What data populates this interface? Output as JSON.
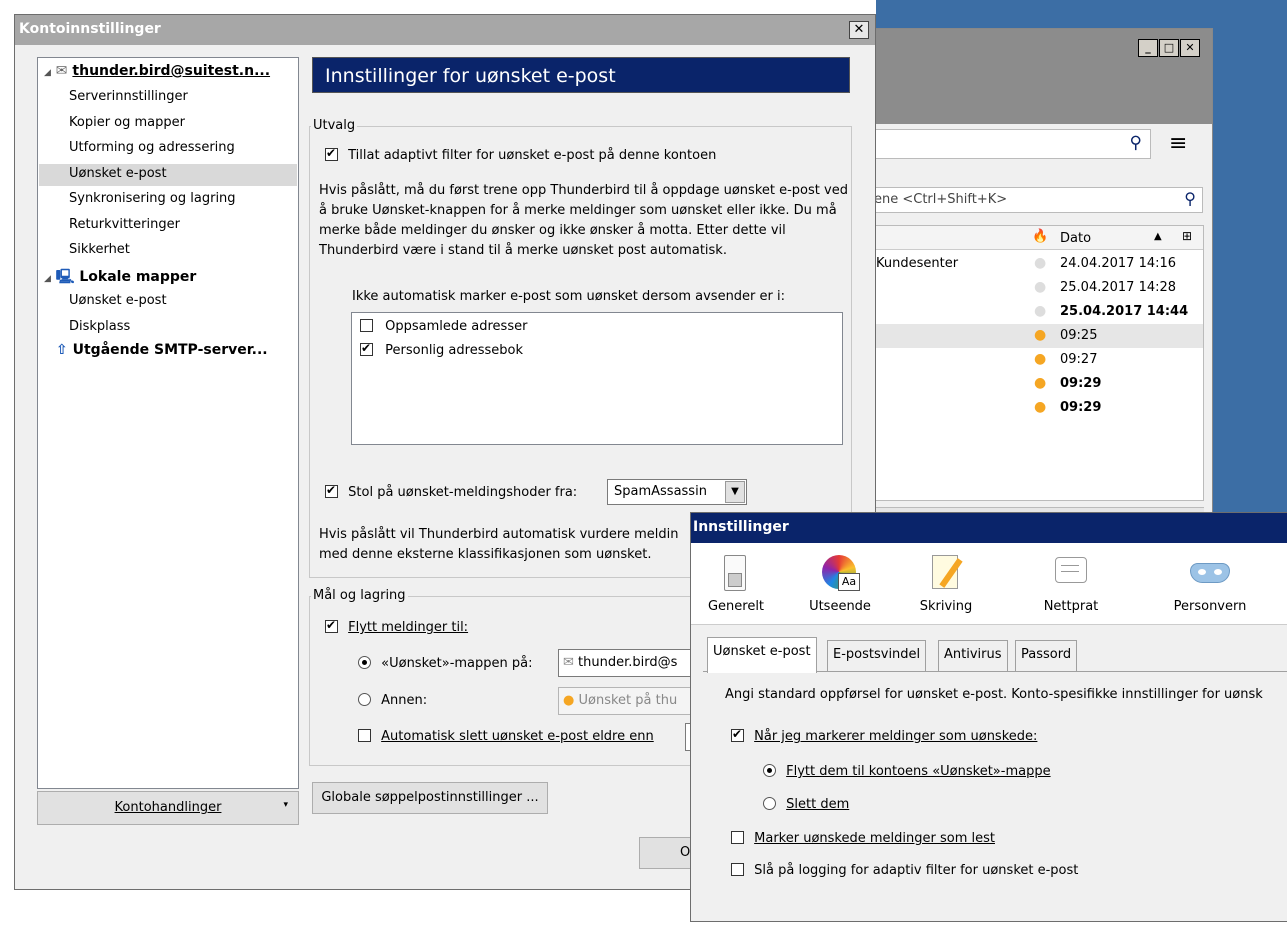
{
  "background_window": {
    "search_icon": "search-icon",
    "menu_icon": "hamburger-menu-icon",
    "quickfilter_placeholder": "ene <Ctrl+Shift+K>",
    "columns": {
      "junk": "junk-icon",
      "date": "Dato"
    },
    "rows": [
      {
        "from": "Kundesenter",
        "date": "24.04.2017 14:16",
        "bold": false,
        "junk": false
      },
      {
        "from": "",
        "date": "25.04.2017 14:28",
        "bold": false,
        "junk": false
      },
      {
        "from": "",
        "date": "25.04.2017 14:44",
        "bold": true,
        "junk": false
      },
      {
        "from": "",
        "date": "09:25",
        "bold": false,
        "junk": true
      },
      {
        "from": "",
        "date": "09:27",
        "bold": false,
        "junk": true
      },
      {
        "from": "",
        "date": "09:29",
        "bold": true,
        "junk": true
      },
      {
        "from": "",
        "date": "09:29",
        "bold": true,
        "junk": true
      }
    ]
  },
  "account_dialog": {
    "title": "Kontoinnstillinger",
    "close_label": "✕",
    "tree": {
      "account": "thunder.bird@suitest.n...",
      "account_items": [
        "Serverinnstillinger",
        "Kopier og mapper",
        "Utforming og adressering",
        "Uønsket e-post",
        "Synkronisering og lagring",
        "Returkvitteringer",
        "Sikkerhet"
      ],
      "local": "Lokale mapper",
      "local_items": [
        "Uønsket e-post",
        "Diskplass"
      ],
      "smtp": "Utgående SMTP-server..."
    },
    "account_actions": "Kontohandlinger",
    "heading": "Innstillinger for uønsket e-post",
    "selection_group": "Utvalg",
    "adaptive_filter_label": "Tillat adaptivt filter for uønsket e-post på denne kontoen",
    "adaptive_filter_checked": true,
    "explanation": "Hvis påslått, må du først trene opp Thunderbird til å oppdage uønsket e-post ved å bruke Uønsket-knappen for å merke meldinger som uønsket eller ikke. Du må merke både meldinger du ønsker og ikke ønsker å motta. Etter dette vil Thunderbird være i stand til å merke uønsket post automatisk.",
    "whitelist_label": "Ikke automatisk marker e-post som uønsket dersom avsender er i:",
    "whitelist": [
      {
        "label": "Oppsamlede adresser",
        "checked": false
      },
      {
        "label": "Personlig adressebok",
        "checked": true
      }
    ],
    "trust_headers_label": "Stol på uønsket-meldingshoder fra:",
    "trust_headers_checked": true,
    "trust_headers_value": "SpamAssassin",
    "trust_explanation_1": "Hvis påslått vil Thunderbird automatisk vurdere meldin",
    "trust_explanation_2": "med denne eksterne klassifikasjonen som uønsket.",
    "destination_group": "Mål og lagring",
    "move_label": "Flytt meldinger til:",
    "move_checked": true,
    "junk_folder_on_label": "«Uønsket»-mappen på:",
    "junk_folder_on_value": "thunder.bird@s",
    "other_label": "Annen:",
    "other_value": "Uønsket på thu",
    "auto_delete_label": "Automatisk slett uønsket e-post eldre enn",
    "auto_delete_checked": false,
    "global_button": "Globale søppelpostinnstillinger ...",
    "ok_button": "O"
  },
  "prefs_dialog": {
    "title": "Innstillinger",
    "panes": [
      {
        "label": "Generelt",
        "icon": "general-switch-icon"
      },
      {
        "label": "Utseende",
        "icon": "color-wheel-icon"
      },
      {
        "label": "Skriving",
        "icon": "notepad-pencil-icon"
      },
      {
        "label": "Nettprat",
        "icon": "chat-bubble-icon"
      },
      {
        "label": "Personvern",
        "icon": "mask-icon"
      }
    ],
    "tabs": [
      "Uønsket e-post",
      "E-postsvindel",
      "Antivirus",
      "Passord"
    ],
    "description": "Angi standard oppførsel for uønsket e-post. Konto-spesifikke innstillinger for uønsk",
    "when_mark_label": "Når jeg markerer meldinger som uønskede:",
    "when_mark_checked": true,
    "move_to_junk_label": "Flytt dem til kontoens «Uønsket»-mappe",
    "delete_label": "Slett dem",
    "mark_read_label": "Marker uønskede meldinger som lest",
    "logging_label": "Slå på logging for adaptiv filter for uønsket e-post"
  },
  "colors": {
    "heading_bg": "#0a246a",
    "selected_row": "#d9d9d9",
    "junk_flame": "#f5a623"
  }
}
